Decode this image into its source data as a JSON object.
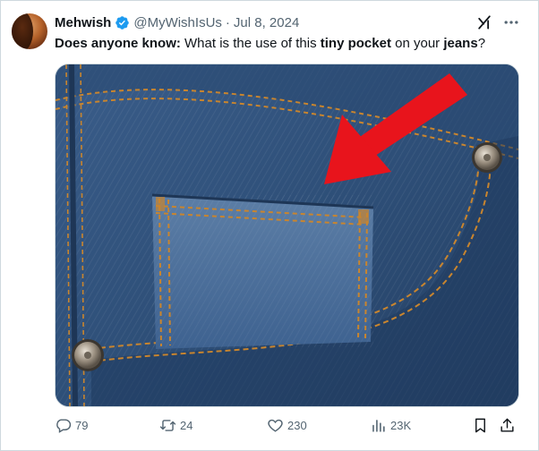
{
  "post": {
    "author_name": "Mehwish",
    "handle": "@MyWishIsUs",
    "separator": "·",
    "date": "Jul 8, 2024",
    "text_parts": [
      {
        "text": "Does anyone know:",
        "bold": true
      },
      {
        "text": " What is the use of this ",
        "bold": false
      },
      {
        "text": "tiny pocket",
        "bold": true
      },
      {
        "text": " on your ",
        "bold": false
      },
      {
        "text": "jeans",
        "bold": true
      },
      {
        "text": "?",
        "bold": false
      }
    ]
  },
  "actions": {
    "replies": "79",
    "reposts": "24",
    "likes": "230",
    "views": "23K"
  },
  "icons": {
    "verified": "verified-badge-icon",
    "grok": "grok-icon",
    "more": "more-icon",
    "reply": "reply-icon",
    "repost": "repost-icon",
    "like": "heart-icon",
    "views": "views-icon",
    "bookmark": "bookmark-icon",
    "share": "share-icon"
  },
  "colors": {
    "verified_blue": "#1d9bf0",
    "secondary_text": "#536471",
    "arrow_red": "#e8141c",
    "denim": "#2f5078"
  }
}
